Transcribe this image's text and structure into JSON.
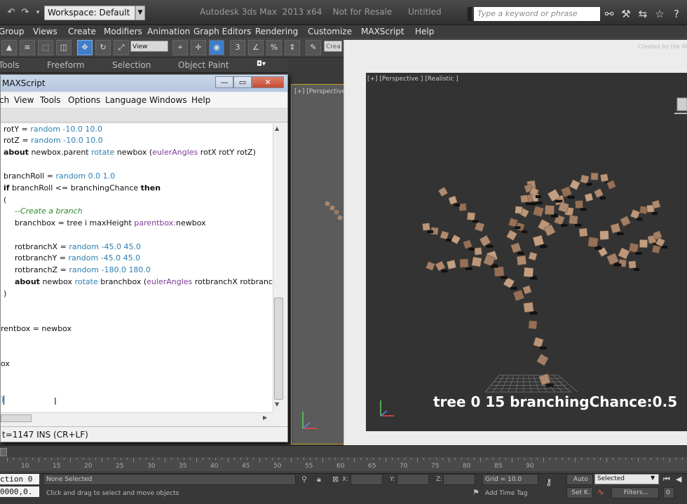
{
  "titlebar": {
    "workspace": "Workspace: Default",
    "app_title": "Autodesk 3ds Max  2013 x64    Not for Resale      Untitled",
    "search_placeholder": "Type a keyword or phrase"
  },
  "menubar": [
    "Group",
    "Views",
    "Create",
    "Modifiers",
    "Animation",
    "Graph Editors",
    "Rendering",
    "Customize",
    "MAXScript",
    "Help"
  ],
  "toolbar": {
    "view_select": "View",
    "create_sel": "Crea"
  },
  "ribbon": {
    "tabs": [
      "Tools",
      "Freeform",
      "Selection",
      "Object Paint"
    ]
  },
  "left_viewport": {
    "label": "[+] [Perspective"
  },
  "editor": {
    "title": "MAXScript",
    "menu": [
      "ch",
      "View",
      "Tools",
      "Options",
      "Language",
      "Windows",
      "Help"
    ],
    "status": "t=1147 INS (CR+LF)"
  },
  "code": {
    "l1": {
      "a": "rotY = ",
      "b": "random",
      "c": " -10.0 10.0"
    },
    "l2": {
      "a": "rotZ = ",
      "b": "random",
      "c": " -10.0 10.0"
    },
    "l3": {
      "a": "about",
      "b": " newbox.parent ",
      "c": "rotate",
      "d": " newbox (",
      "e": "eulerAngles",
      "f": " rotX rotY rotZ)"
    },
    "l4": {
      "a": "branchRoll = ",
      "b": "random",
      "c": " 0.0 1.0"
    },
    "l5": {
      "a": "if",
      "b": " branchRoll <= branchingChance ",
      "c": "then"
    },
    "l6": "(",
    "l7": "--Create a branch",
    "l8": {
      "a": "branchbox = tree i maxHeight ",
      "b": "parentbox:",
      "c": "newbox"
    },
    "l9": {
      "a": "rotbranchX = ",
      "b": "random",
      "c": " -45.0 45.0"
    },
    "l10": {
      "a": "rotbranchY = ",
      "b": "random",
      "c": " -45.0 45.0"
    },
    "l11": {
      "a": "rotbranchZ = ",
      "b": "random",
      "c": " -180.0 180.0"
    },
    "l12": {
      "a": "about",
      "b": " newbox ",
      "c": "rotate",
      "d": " branchbox (",
      "e": "eulerAngles",
      "f": " rotbranchX rotbranchY"
    },
    "l13": ")",
    "l14": "rentbox = newbox",
    "l15": "ox",
    "l16": ")"
  },
  "render": {
    "viewport_label": "[+] [Perspective ] [Realistic ]",
    "caption": "tree 0 15 branchingChance:0.5",
    "watermark": "Created by the Wi"
  },
  "timeline": {
    "ticks": [
      "10",
      "15",
      "20",
      "25",
      "30",
      "35",
      "40",
      "45",
      "50",
      "55",
      "60",
      "65",
      "70",
      "75",
      "80",
      "85",
      "90"
    ]
  },
  "statusbar": {
    "selection_count": "None Selected",
    "prompt": "Click and drag to select and move objects",
    "x_label": "X:",
    "y_label": "Y:",
    "z_label": "Z:",
    "grid": "Grid = 10.0",
    "add_time_tag": "Add Time Tag",
    "auto": "Auto",
    "selected": "Selected",
    "set_k": "Set K.",
    "filters": "Filters...",
    "listener_top": "ction 0",
    "listener_bottom": "0000,0."
  },
  "colors": {
    "accent_viewport_border": "#c9a227",
    "code_keyword_fn": "#2e7fb0",
    "code_comment": "#2d8a2d"
  }
}
